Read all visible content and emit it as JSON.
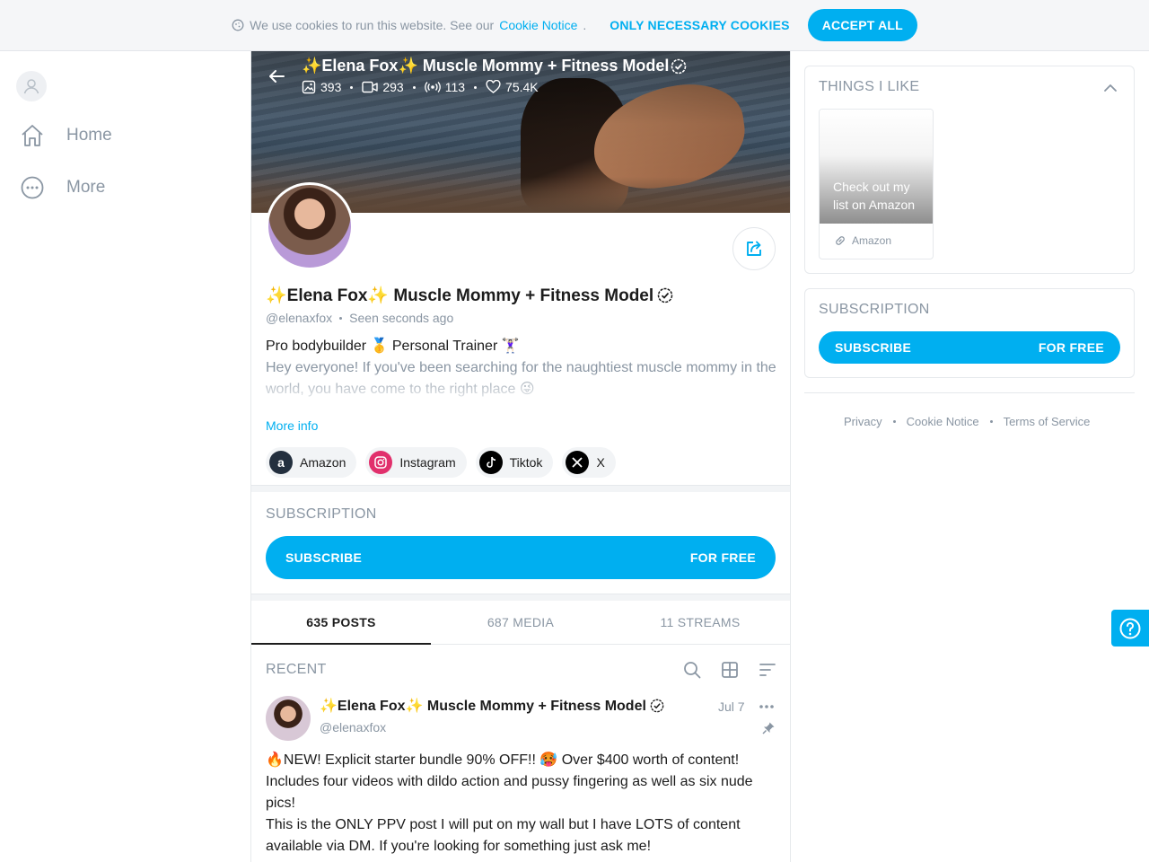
{
  "cookie": {
    "text": "We use cookies to run this website. See our",
    "link": "Cookie Notice",
    "link_suffix": ".",
    "necessary_label": "ONLY NECESSARY COOKIES",
    "accept_label": "ACCEPT ALL"
  },
  "nav": {
    "items": [
      {
        "label": "Home",
        "icon": "home-icon"
      },
      {
        "label": "More",
        "icon": "more-circle-icon"
      }
    ]
  },
  "profile": {
    "banner_title": "✨Elena Fox✨ Muscle Mommy + Fitness Model",
    "stats": {
      "photos": "393",
      "videos": "293",
      "streams": "113",
      "likes": "75.4K"
    },
    "name": "✨Elena Fox✨ Muscle Mommy + Fitness Model",
    "handle": "@elenaxfox",
    "seen_label": "Seen",
    "seen_value": "seconds ago",
    "bio_line1": "Pro bodybuilder 🥇 Personal Trainer 🏋🏻‍♀️",
    "bio_line2": "Hey everyone! If you've been searching for the naughtiest muscle mommy in the world, you have come to the right place 😜",
    "more_info_label": "More info",
    "socials": [
      {
        "label": "Amazon",
        "icon": "amazon-icon",
        "color": "#232f3e"
      },
      {
        "label": "Instagram",
        "icon": "instagram-icon",
        "color": "#e1306c"
      },
      {
        "label": "Tiktok",
        "icon": "tiktok-icon",
        "color": "#000000"
      },
      {
        "label": "X",
        "icon": "x-icon",
        "color": "#000000"
      }
    ]
  },
  "subscription": {
    "title": "SUBSCRIPTION",
    "button_label": "SUBSCRIBE",
    "button_price": "FOR FREE"
  },
  "tabs": [
    {
      "label": "635 POSTS",
      "active": true
    },
    {
      "label": "687 MEDIA",
      "active": false
    },
    {
      "label": "11 STREAMS",
      "active": false
    }
  ],
  "recent": {
    "title": "RECENT"
  },
  "post": {
    "author": "✨Elena Fox✨ Muscle Mommy + Fitness Model",
    "handle": "@elenaxfox",
    "date": "Jul 7",
    "body_line1": "🔥NEW! Explicit starter bundle 90% OFF!! 🥵 Over $400 worth of content!",
    "body_line2": "Includes four videos with dildo action and pussy fingering as well as six nude pics!",
    "body_line3": "This is the ONLY PPV post I will put on my wall but I have LOTS of content available via DM. If you're looking for something just ask me!"
  },
  "sidebar": {
    "things_title": "THINGS I LIKE",
    "amazon_tile_text": "Check out my list on Amazon",
    "amazon_link_label": "Amazon",
    "subscription_title": "SUBSCRIPTION",
    "subscribe_label": "SUBSCRIBE",
    "subscribe_price": "FOR FREE"
  },
  "footer": {
    "links": [
      "Privacy",
      "Cookie Notice",
      "Terms of Service"
    ]
  },
  "colors": {
    "accent": "#00aff0",
    "muted": "#8a96a3",
    "text": "#1c1c1c"
  }
}
